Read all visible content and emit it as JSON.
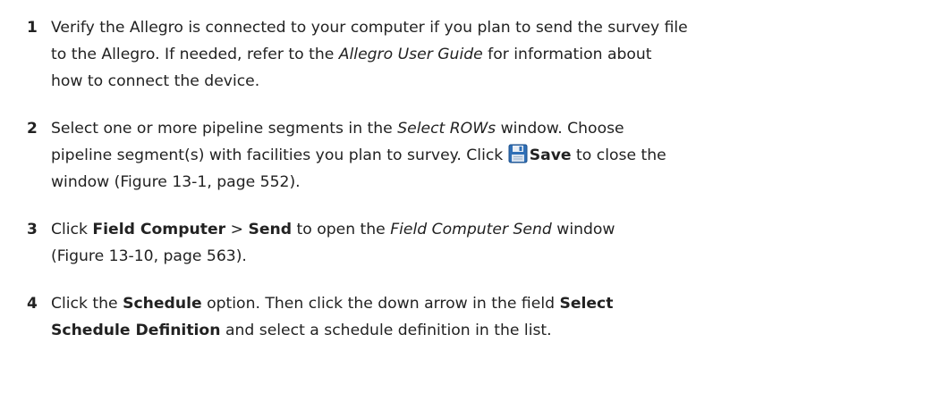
{
  "steps": [
    {
      "number": "1",
      "l1": "Verify the Allegro is connected to your computer if you plan to send the survey file",
      "l2a": "to the Allegro. If needed, refer to the ",
      "l2b": "Allegro User Guide",
      "l2c": " for information about",
      "l3": "how to connect the device."
    },
    {
      "number": "2",
      "l1a": "Select one or more pipeline segments in the ",
      "l1b": "Select ROWs",
      "l1c": " window. Choose",
      "l2a": "pipeline segment(s) with facilities you plan to survey. Click ",
      "l2b": "Save",
      "l2c": " to close the",
      "l3": "window (Figure 13-1, page 552).",
      "icon": "save-icon"
    },
    {
      "number": "3",
      "l1a": "Click ",
      "l1b": "Field Computer",
      "l1c": " > ",
      "l1d": "Send",
      "l1e": " to open the ",
      "l1f": "Field Computer Send",
      "l1g": " window",
      "l2": "(Figure 13-10, page 563)."
    },
    {
      "number": "4",
      "l1a": "Click the ",
      "l1b": "Schedule",
      "l1c": " option. Then click the down arrow in the field ",
      "l1d": "Select",
      "l2a": "Schedule Definition",
      "l2b": " and select a schedule definition in the list."
    }
  ]
}
